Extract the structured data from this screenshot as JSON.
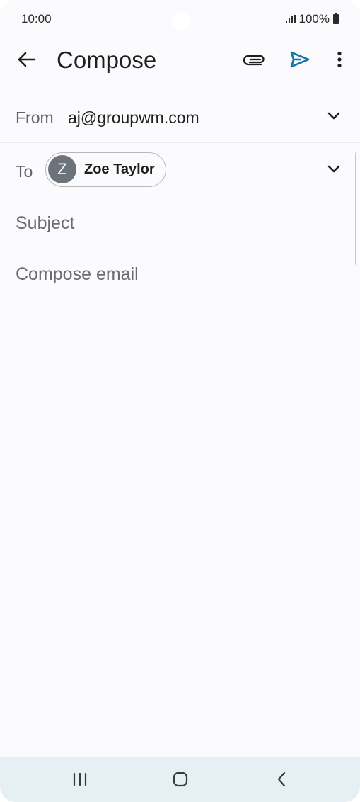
{
  "status_bar": {
    "time": "10:00",
    "battery": "100%",
    "icons": [
      "signal-icon",
      "battery-icon"
    ]
  },
  "app_bar": {
    "title": "Compose",
    "icons": [
      "back-arrow-icon",
      "paperclip-icon",
      "send-icon",
      "more-vert-icon"
    ]
  },
  "from": {
    "label": "From",
    "value": "aj@groupwm.com"
  },
  "to": {
    "label": "To",
    "recipient": {
      "initial": "Z",
      "name": "Zoe Taylor"
    }
  },
  "subject": {
    "placeholder": "Subject"
  },
  "body": {
    "placeholder": "Compose email"
  },
  "nav": {
    "icons": [
      "recents-icon",
      "home-icon",
      "back-icon"
    ]
  },
  "colors": {
    "accent_send": "#1a73a8",
    "background": "#fbfbfd",
    "nav_background": "#e6eff3",
    "avatar": "#6d737a"
  }
}
